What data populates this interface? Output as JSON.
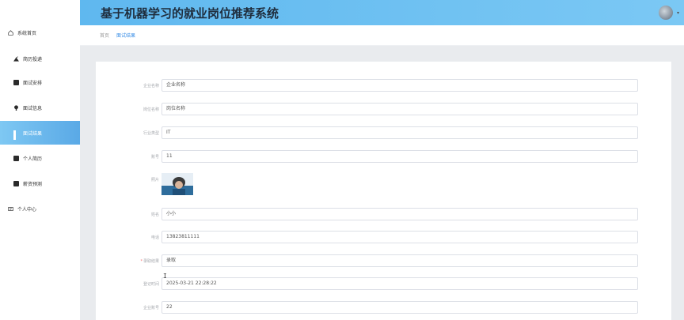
{
  "header": {
    "title": "基于机器学习的就业岗位推荐系统",
    "avatar_icon": "user-avatar-icon",
    "caret": "▾"
  },
  "sidebar": {
    "items": [
      {
        "label": "系统首页",
        "icon": "home-icon"
      },
      {
        "label": "简历投递",
        "icon": "send-icon"
      },
      {
        "label": "面试安排",
        "icon": "calendar-icon"
      },
      {
        "label": "面试信息",
        "icon": "info-icon"
      },
      {
        "label": "面试结果",
        "icon": "grid-icon",
        "active": true
      },
      {
        "label": "个人简历",
        "icon": "document-icon"
      },
      {
        "label": "薪资预测",
        "icon": "chart-icon"
      },
      {
        "label": "个人中心",
        "icon": "person-card-icon"
      }
    ]
  },
  "breadcrumb": {
    "home": "首页",
    "current": "面试结果"
  },
  "form": {
    "fields": [
      {
        "label": "企业名称",
        "value": "企业名称"
      },
      {
        "label": "岗位名称",
        "value": "岗位名称"
      },
      {
        "label": "行业类型",
        "value": "IT"
      },
      {
        "label": "账号",
        "value": "11"
      },
      {
        "label": "照片",
        "value": ""
      },
      {
        "label": "姓名",
        "value": "小小"
      },
      {
        "label": "电话",
        "value": "13823811111"
      },
      {
        "label": "录取结果",
        "value": "录取",
        "required": true
      },
      {
        "label": "登记时间",
        "value": "2025-03-21 22:28:22"
      },
      {
        "label": "企业账号",
        "value": "22"
      }
    ]
  },
  "colors": {
    "header_gradient_start": "#5fb8ef",
    "active_item": "#5aa9e6",
    "breadcrumb_current": "#3a8ee6",
    "required": "#f56c6c"
  }
}
